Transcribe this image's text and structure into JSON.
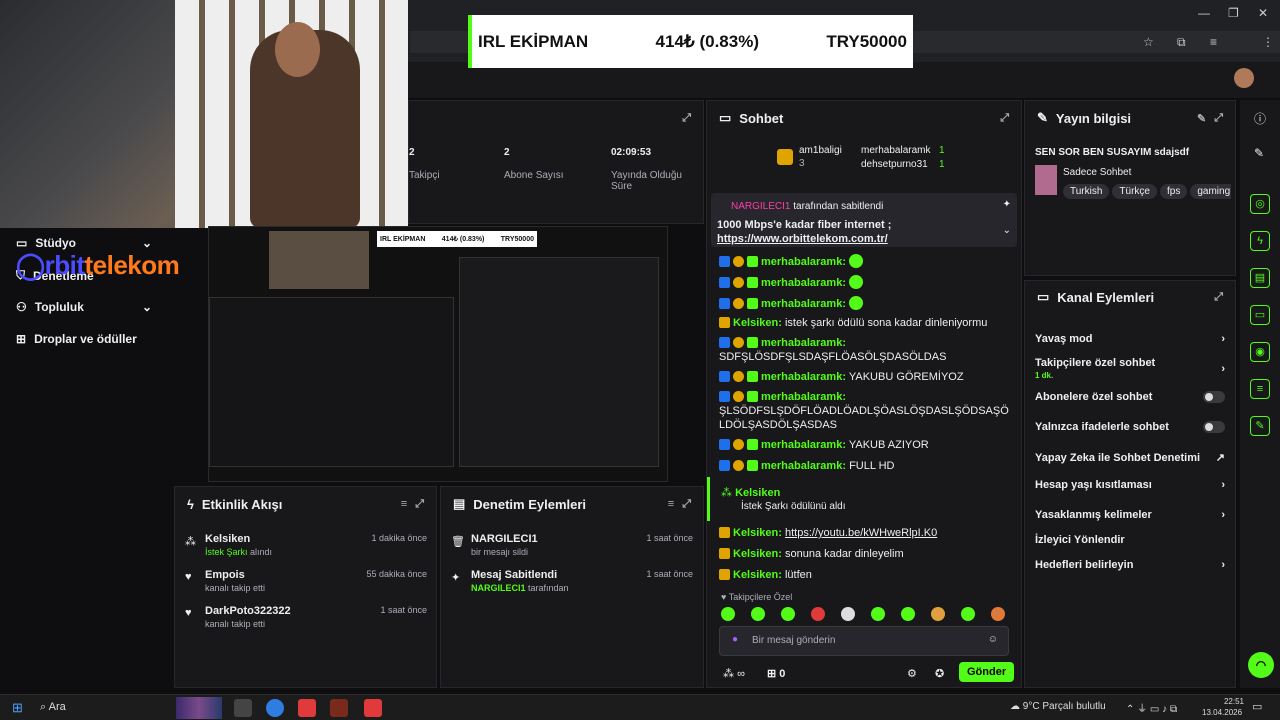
{
  "ticker": {
    "left": "IRL EKİPMAN",
    "mid": "414₺ (0.83%)",
    "right": "TRY50000"
  },
  "nav": {
    "items": [
      {
        "label": "Stüdyo"
      },
      {
        "label": "Denetleme"
      },
      {
        "label": "Topluluk"
      },
      {
        "label": "Droplar ve ödüller"
      }
    ]
  },
  "logo": {
    "part1": "rbit",
    "part2": "telekom"
  },
  "stats": {
    "s1_value": "2",
    "s1_label": "Takipçi",
    "s2_value": "2",
    "s2_label": "Abone Sayısı",
    "s3_value": "02:09:53",
    "s3_label": "Yayında Olduğu Süre"
  },
  "preview": {
    "ticker_left": "IRL EKİPMAN",
    "ticker_mid": "414₺ (0.83%)",
    "ticker_right": "TRY50000"
  },
  "chat": {
    "title": "Sohbet",
    "leader1": "am1baligi",
    "leader1_count": "3",
    "leader2": "merhabalaramk",
    "leader2_count": "1",
    "leader3": "dehsetpurno31",
    "leader3_count": "1",
    "pinned_by": "NARGILECI1",
    "pinned_suffix": "tarafından sabitlendi",
    "pinned_text": "1000 Mbps'e kadar fiber internet ;",
    "pinned_link": "https://www.orbittelekom.com.tr/",
    "messages": [
      {
        "user": "merhabalaramk:",
        "text": ""
      },
      {
        "user": "merhabalaramk:",
        "text": ""
      },
      {
        "user": "merhabalaramk:",
        "text": ""
      },
      {
        "user": "Kelsiken:",
        "text": "istek şarkı ödülü sona kadar dinleniyormu"
      },
      {
        "user": "merhabalaramk:",
        "text": "SDFŞLÖSDFŞLSDAŞFLÖASÖLŞDASÖLDAS"
      },
      {
        "user": "merhabalaramk:",
        "text": "YAKUBU GÖREMİYOZ"
      },
      {
        "user": "merhabalaramk:",
        "text": "ŞLSÖDFSLŞDÖFLÖADLÖADLŞÖASLÖŞDASLŞÖDSAŞÖLDÖLŞASDÖLŞASDAS"
      },
      {
        "user": "merhabalaramk:",
        "text": "YAKUB AZIYOR"
      },
      {
        "user": "merhabalaramk:",
        "text": "FULL HD"
      }
    ],
    "reward_user": "Kelsiken",
    "reward_text": "İstek Şarkı ödülünü aldı",
    "m10_user": "Kelsiken:",
    "m10_link": "https://youtu.be/kWHweRlpI.K0",
    "m11_user": "Kelsiken:",
    "m11_text": "sonuna kadar dinleyelim",
    "m12_user": "Kelsiken:",
    "m12_text": "lütfen",
    "followers_label": "Takipçilere Özel",
    "input_placeholder": "Bir mesaj gönderin",
    "points": "∞",
    "gift_count": "0",
    "send_label": "Gönder"
  },
  "info": {
    "title": "Yayın bilgisi",
    "stream_title": "SEN SOR BEN SUSAYIM sdajsdf",
    "category": "Sadece Sohbet",
    "tags": [
      "Turkish",
      "Türkçe",
      "fps",
      "gaming"
    ]
  },
  "actions": {
    "title": "Kanal Eylemleri",
    "items": [
      {
        "label": "Yavaş mod"
      },
      {
        "label": "Takipçilere özel sohbet",
        "sub": "1 dk."
      },
      {
        "label": "Abonelere özel sohbet"
      },
      {
        "label": "Yalnızca ifadelerle sohbet"
      },
      {
        "label": "Yapay Zeka ile Sohbet Denetimi"
      },
      {
        "label": "Hesap yaşı kısıtlaması"
      },
      {
        "label": "Yasaklanmış kelimeler"
      },
      {
        "label": "İzleyici Yönlendir"
      },
      {
        "label": "Hedefleri belirleyin"
      }
    ]
  },
  "activity": {
    "title": "Etkinlik Akışı",
    "events": [
      {
        "name": "Kelsiken",
        "sub_hl": "İstek Şarkı",
        "sub": "alındı",
        "time": "1 dakika önce"
      },
      {
        "name": "Empois",
        "sub": "kanalı takip etti",
        "time": "55 dakika önce"
      },
      {
        "name": "DarkPoto322322",
        "sub": "kanalı takip etti",
        "time": "1 saat önce"
      }
    ]
  },
  "mod": {
    "title": "Denetim Eylemleri",
    "events": [
      {
        "name": "NARGILECI1",
        "sub": "bir mesajı sildi",
        "time": "1 saat önce"
      },
      {
        "name": "Mesaj Sabitlendi",
        "sub_hl": "NARGILECI1",
        "sub": "tarafından",
        "time": "1 saat önce"
      }
    ]
  },
  "taskbar": {
    "search": "Ara",
    "weather": "9°C  Parçalı bulutlu",
    "time": "22:51",
    "date": "13.04.2026"
  },
  "colors": {
    "accent": "#53fc18",
    "bg": "#0e0e10",
    "panel": "#18181b"
  }
}
